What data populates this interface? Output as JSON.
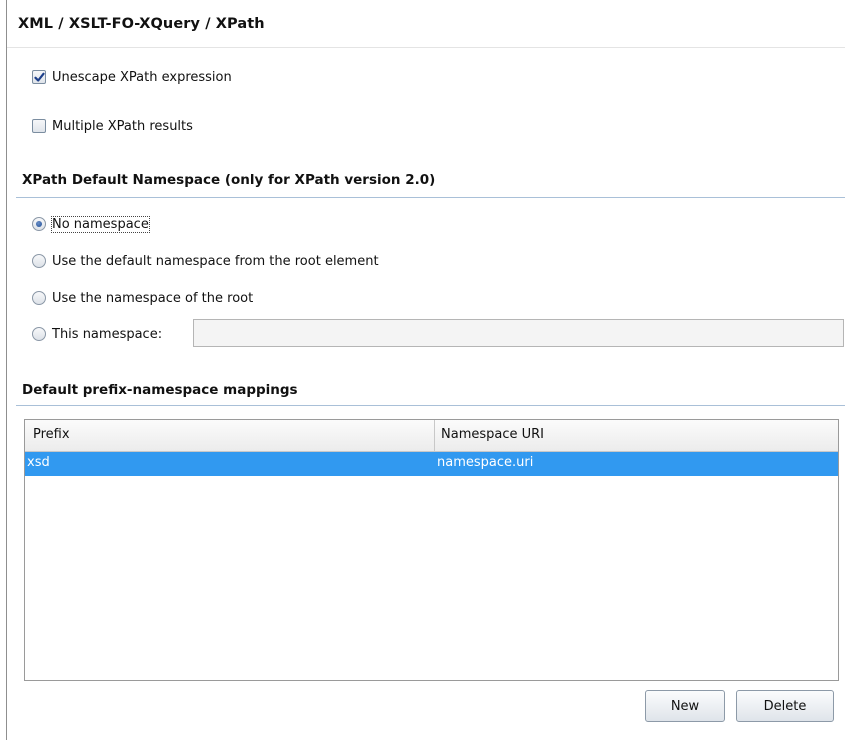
{
  "page": {
    "title": "XML / XSLT-FO-XQuery / XPath"
  },
  "options": {
    "unescape_label": "Unescape XPath expression",
    "unescape_checked": true,
    "multiple_label": "Multiple XPath results",
    "multiple_checked": false
  },
  "namespace_section": {
    "title": "XPath Default Namespace (only for XPath version 2.0)",
    "options": [
      {
        "label": "No namespace",
        "selected": true
      },
      {
        "label": "Use the default namespace from the root element",
        "selected": false
      },
      {
        "label": "Use the namespace of the root",
        "selected": false
      },
      {
        "label": "This namespace:",
        "selected": false
      }
    ],
    "this_namespace_value": ""
  },
  "mappings_section": {
    "title": "Default prefix-namespace mappings",
    "columns": [
      "Prefix",
      "Namespace URI"
    ],
    "rows": [
      {
        "prefix": "xsd",
        "uri": "namespace.uri",
        "selected": true
      }
    ],
    "new_button": "New",
    "delete_button": "Delete"
  },
  "colors": {
    "selection": "#3199f0",
    "section_rule": "#a9c0d8"
  }
}
